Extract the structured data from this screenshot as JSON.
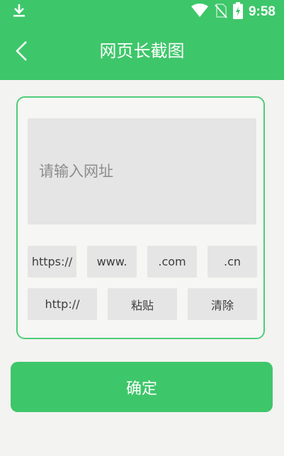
{
  "status_bar": {
    "time": "9:58",
    "icons": [
      "download-icon",
      "wifi-icon",
      "no-sim-icon",
      "battery-charging-icon"
    ]
  },
  "header": {
    "title": "网页长截图",
    "back_icon": "chevron-left-icon"
  },
  "url_input": {
    "value": "",
    "placeholder": "请输入网址"
  },
  "shortcuts": {
    "row1": [
      "https://",
      "www.",
      ".com",
      ".cn"
    ],
    "row2": [
      "http://",
      "粘贴",
      "清除"
    ]
  },
  "confirm_label": "确定",
  "colors": {
    "accent": "#3ec66a",
    "background": "#f3f3f1",
    "chip": "#e5e5e5"
  }
}
